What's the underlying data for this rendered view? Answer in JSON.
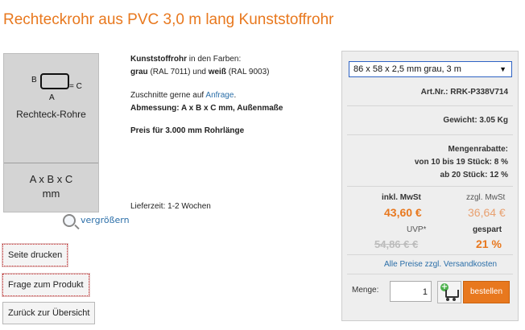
{
  "title": "Rechteckrohr aus PVC 3,0 m lang Kunststoffrohr",
  "image": {
    "label_b": "B",
    "label_a": "A",
    "label_c": "= C",
    "caption": "Rechteck-Rohre",
    "formula": "A x B x C",
    "unit": "mm",
    "zoom_label": "vergrößern"
  },
  "description": {
    "line1_bold": "Kunststoffrohr",
    "line1_rest": " in den Farben:",
    "line2_bold_a": "grau",
    "line2_mid": " (RAL 7011) und ",
    "line2_bold_b": "weiß",
    "line2_end": " (RAL 9003)",
    "line3_pre": "Zuschnitte gerne auf ",
    "line3_link": "Anfrage",
    "line3_end": ".",
    "line4_bold": "Abmessung: A x B x C mm, Außenmaße",
    "line5_bold": "Preis für 3.000 mm Rohrlänge",
    "delivery": "Lieferzeit: 1-2 Wochen"
  },
  "buttons": {
    "print": "Seite drucken",
    "question": "Frage zum Produkt",
    "back": "Zurück zur Übersicht"
  },
  "buybox": {
    "variant_selected": "86 x 58 x 2,5 mm grau, 3 m",
    "article_no": "Art.Nr.: RRK-P338V714",
    "weight": "Gewicht: 3.05 Kg",
    "discount_title": "Mengenrabatte:",
    "discount_1": "von 10 bis 19 Stück: 8 %",
    "discount_2": "ab 20 Stück: 12 %",
    "incl_label": "inkl. MwSt",
    "excl_label": "zzgl. MwSt",
    "price_incl": "43,60 €",
    "price_excl": "36,64 €",
    "uvp_label": "UVP*",
    "uvp_price": "54,86 € €",
    "saved_label": "gespart",
    "saved_value": "21 %",
    "shipping_link": "Alle Preise zzgl. Versandkosten",
    "qty_label": "Menge:",
    "qty_value": "1",
    "order_label": "bestellen"
  },
  "colors": {
    "accent": "#e8781e",
    "link": "#2a6ea8"
  }
}
